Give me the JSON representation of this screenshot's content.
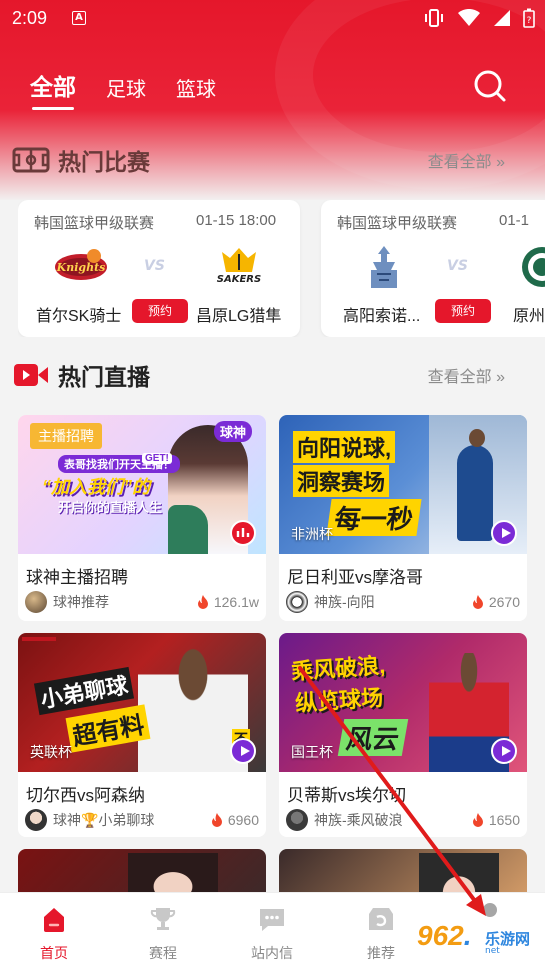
{
  "status_bar": {
    "time": "2:09",
    "notification_icon": "A"
  },
  "header": {
    "tabs": [
      {
        "label": "全部",
        "active": true
      },
      {
        "label": "足球",
        "active": false
      },
      {
        "label": "篮球",
        "active": false
      }
    ]
  },
  "hot_matches": {
    "title": "热门比赛",
    "view_all": "查看全部",
    "chevron": "»",
    "matches": [
      {
        "league": "韩国篮球甲级联赛",
        "time": "01-15 18:00",
        "home": "首尔SK骑士",
        "away": "昌原LG猎隼",
        "vs": "VS",
        "home_logo_text": "Knights",
        "away_logo_text": "SAKERS",
        "action": "预约"
      },
      {
        "league": "韩国篮球甲级联赛",
        "time": "01-1",
        "home": "高阳索诺...",
        "away": "原州",
        "vs": "VS",
        "action": "预约"
      }
    ]
  },
  "hot_live": {
    "title": "热门直播",
    "view_all": "查看全部",
    "chevron": "»",
    "streams": [
      {
        "title": "球神主播招聘",
        "host": "球神推荐",
        "heat": "126.1w",
        "badge": "主播招聘",
        "brand": "球神",
        "thumb_banner": "表哥找我们开天主播！",
        "thumb_line1": "“加入我们”的",
        "thumb_line2": "开启你的直播人生",
        "thumb_small": "GET!"
      },
      {
        "title": "尼日利亚vs摩洛哥",
        "host": "神族-向阳",
        "heat": "2670",
        "tag": "非洲杯",
        "thumb_line1": "向阳说球,",
        "thumb_line2": "洞察赛场",
        "thumb_line3": "每一秒"
      },
      {
        "title": "切尔西vs阿森纳",
        "host": "球神🏆小弟聊球",
        "heat": "6960",
        "tag": "英联杯",
        "thumb_line1": "小弟聊球",
        "thumb_line2": "超有料",
        "thumb_small": "不"
      },
      {
        "title": "贝蒂斯vs埃尔切",
        "host": "神族-乘风破浪",
        "heat": "1650",
        "tag": "国王杯",
        "thumb_line1": "乘风破浪,",
        "thumb_line2": "纵览球场",
        "thumb_line3": "风云"
      }
    ]
  },
  "bottom_nav": [
    {
      "label": "首页",
      "icon": "home-icon",
      "active": true
    },
    {
      "label": "赛程",
      "icon": "trophy-icon",
      "active": false
    },
    {
      "label": "站内信",
      "icon": "message-icon",
      "active": false
    },
    {
      "label": "推荐",
      "icon": "recommend-icon",
      "active": false
    }
  ],
  "watermark": {
    "number": "962",
    "dot": ".",
    "suffix": "net",
    "site": "乐游网"
  },
  "colors": {
    "primary_red": "#e5172b",
    "live_purple": "#7b2bd6",
    "badge_yellow": "#f7b733"
  }
}
